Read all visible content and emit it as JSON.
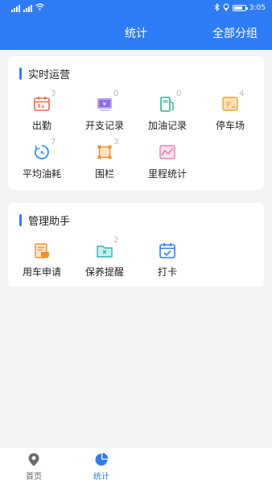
{
  "status_bar": {
    "time": "3:05",
    "battery_level": 0.8
  },
  "nav": {
    "title": "统计",
    "action": "全部分组"
  },
  "realtime": {
    "title": "实时运营",
    "items": [
      {
        "label": "出勤",
        "count": "3",
        "icon": "attendance-icon",
        "color": "#e96a4a"
      },
      {
        "label": "开支记录",
        "count": "0",
        "icon": "expense-icon",
        "color": "#8e6ee6"
      },
      {
        "label": "加油记录",
        "count": "0",
        "icon": "fuel-icon",
        "color": "#28b89a"
      },
      {
        "label": "停车场",
        "count": "4",
        "icon": "parking-icon",
        "color": "#f0a43c"
      },
      {
        "label": "平均油耗",
        "count": "7",
        "icon": "avg-fuel-icon",
        "color": "#2f8ef0"
      },
      {
        "label": "围栏",
        "count": "3",
        "icon": "fence-icon",
        "color": "#f0902c"
      },
      {
        "label": "里程统计",
        "count": "",
        "icon": "mileage-icon",
        "color": "#e480b8"
      }
    ]
  },
  "assistant": {
    "title": "管理助手",
    "items": [
      {
        "label": "用车申请",
        "count": "",
        "icon": "car-request-icon",
        "color": "#f0902c"
      },
      {
        "label": "保养提醒",
        "count": "2",
        "icon": "maintenance-icon",
        "color": "#2fb7b0"
      },
      {
        "label": "打卡",
        "count": "",
        "icon": "checkin-icon",
        "color": "#2f7df6"
      }
    ]
  },
  "tabbar": {
    "items": [
      {
        "label": "首页",
        "icon": "location-pin-icon",
        "active": false
      },
      {
        "label": "统计",
        "icon": "pie-chart-icon",
        "active": true
      }
    ]
  },
  "colors": {
    "primary": "#2f7df6",
    "background": "#f3f4f6"
  }
}
